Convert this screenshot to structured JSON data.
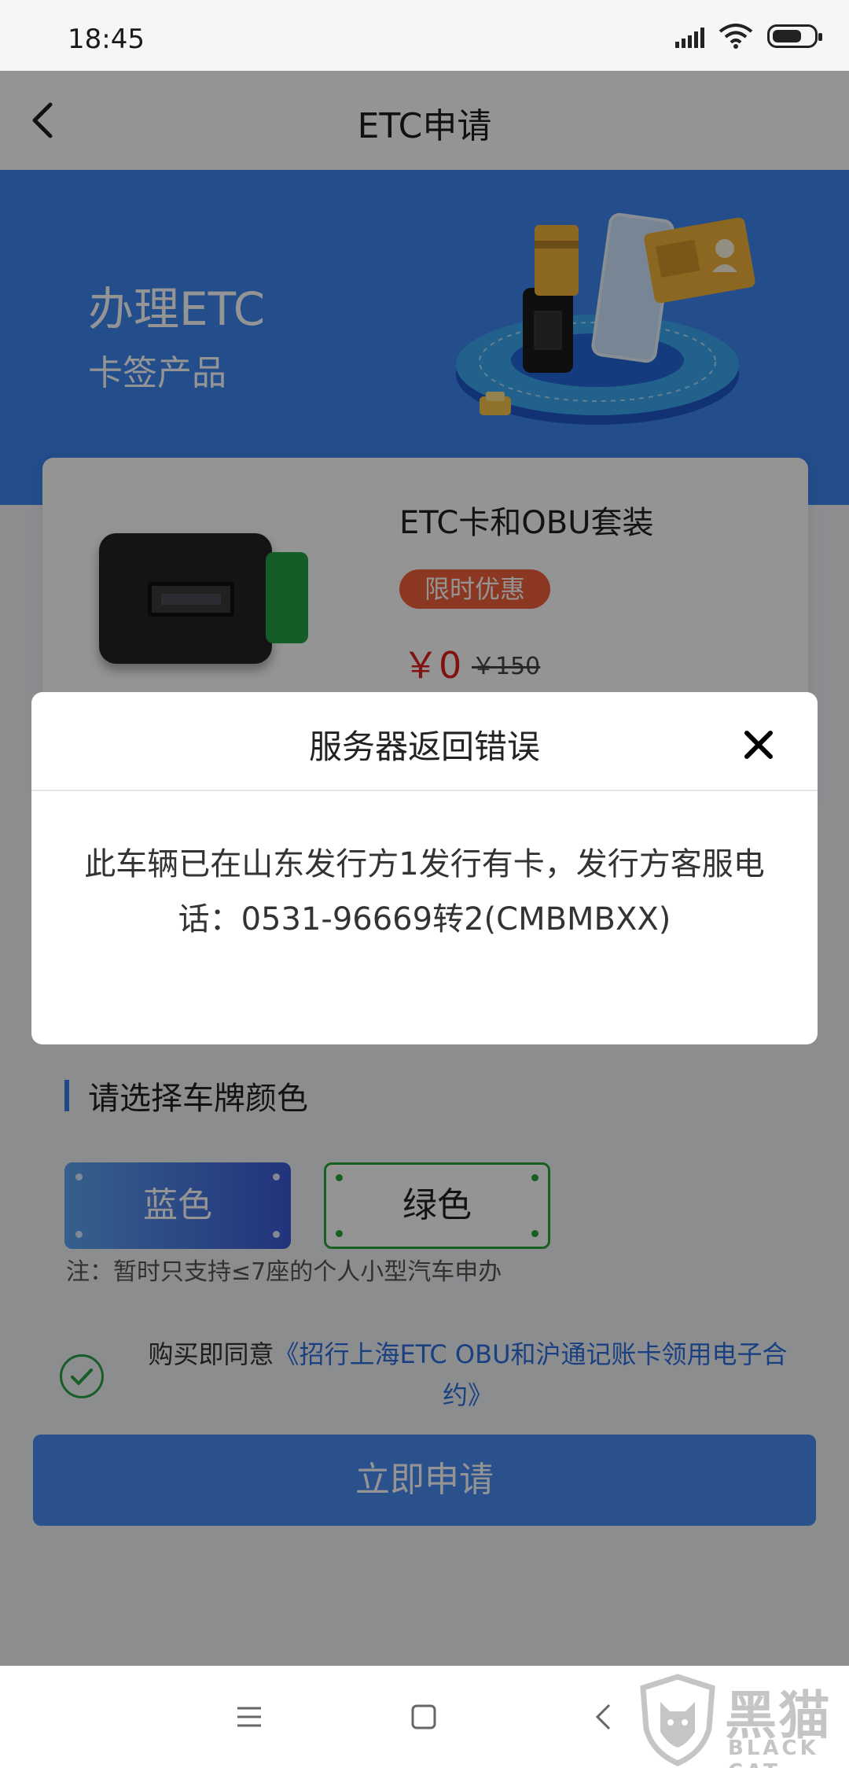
{
  "status_bar": {
    "time": "18:45"
  },
  "header": {
    "title": "ETC申请",
    "back_icon": "chevron-left-icon"
  },
  "hero": {
    "title": "办理ETC",
    "subtitle": "卡签产品"
  },
  "product": {
    "name": "ETC卡和OBU套装",
    "promo_badge": "限时优惠",
    "price": "￥0",
    "original_price": "￥150"
  },
  "plate_color": {
    "section_title": "请选择车牌颜色",
    "options": [
      {
        "label": "蓝色",
        "color": "#3d6fe0"
      },
      {
        "label": "绿色",
        "color": "#2aa43c"
      }
    ],
    "note": "注：暂时只支持≤7座的个人小型汽车申办"
  },
  "agreement": {
    "prefix": "购买即同意",
    "link_text": "《招行上海ETC OBU和沪通记账卡领用电子合约》"
  },
  "apply_button": {
    "label": "立即申请",
    "color": "#4b8cf3"
  },
  "dialog": {
    "title": "服务器返回错误",
    "message": "此车辆已在山东发行方1发行有卡，发行方客服电话：0531-96669转2(CMBMBXX)",
    "close_icon": "close-icon"
  },
  "system_nav": {
    "menu_icon": "menu-icon",
    "home_icon": "square-home-icon",
    "back_icon": "back-triangle-icon"
  },
  "watermark": {
    "text_cn": "黑猫",
    "text_en": "BLACK CAT"
  }
}
